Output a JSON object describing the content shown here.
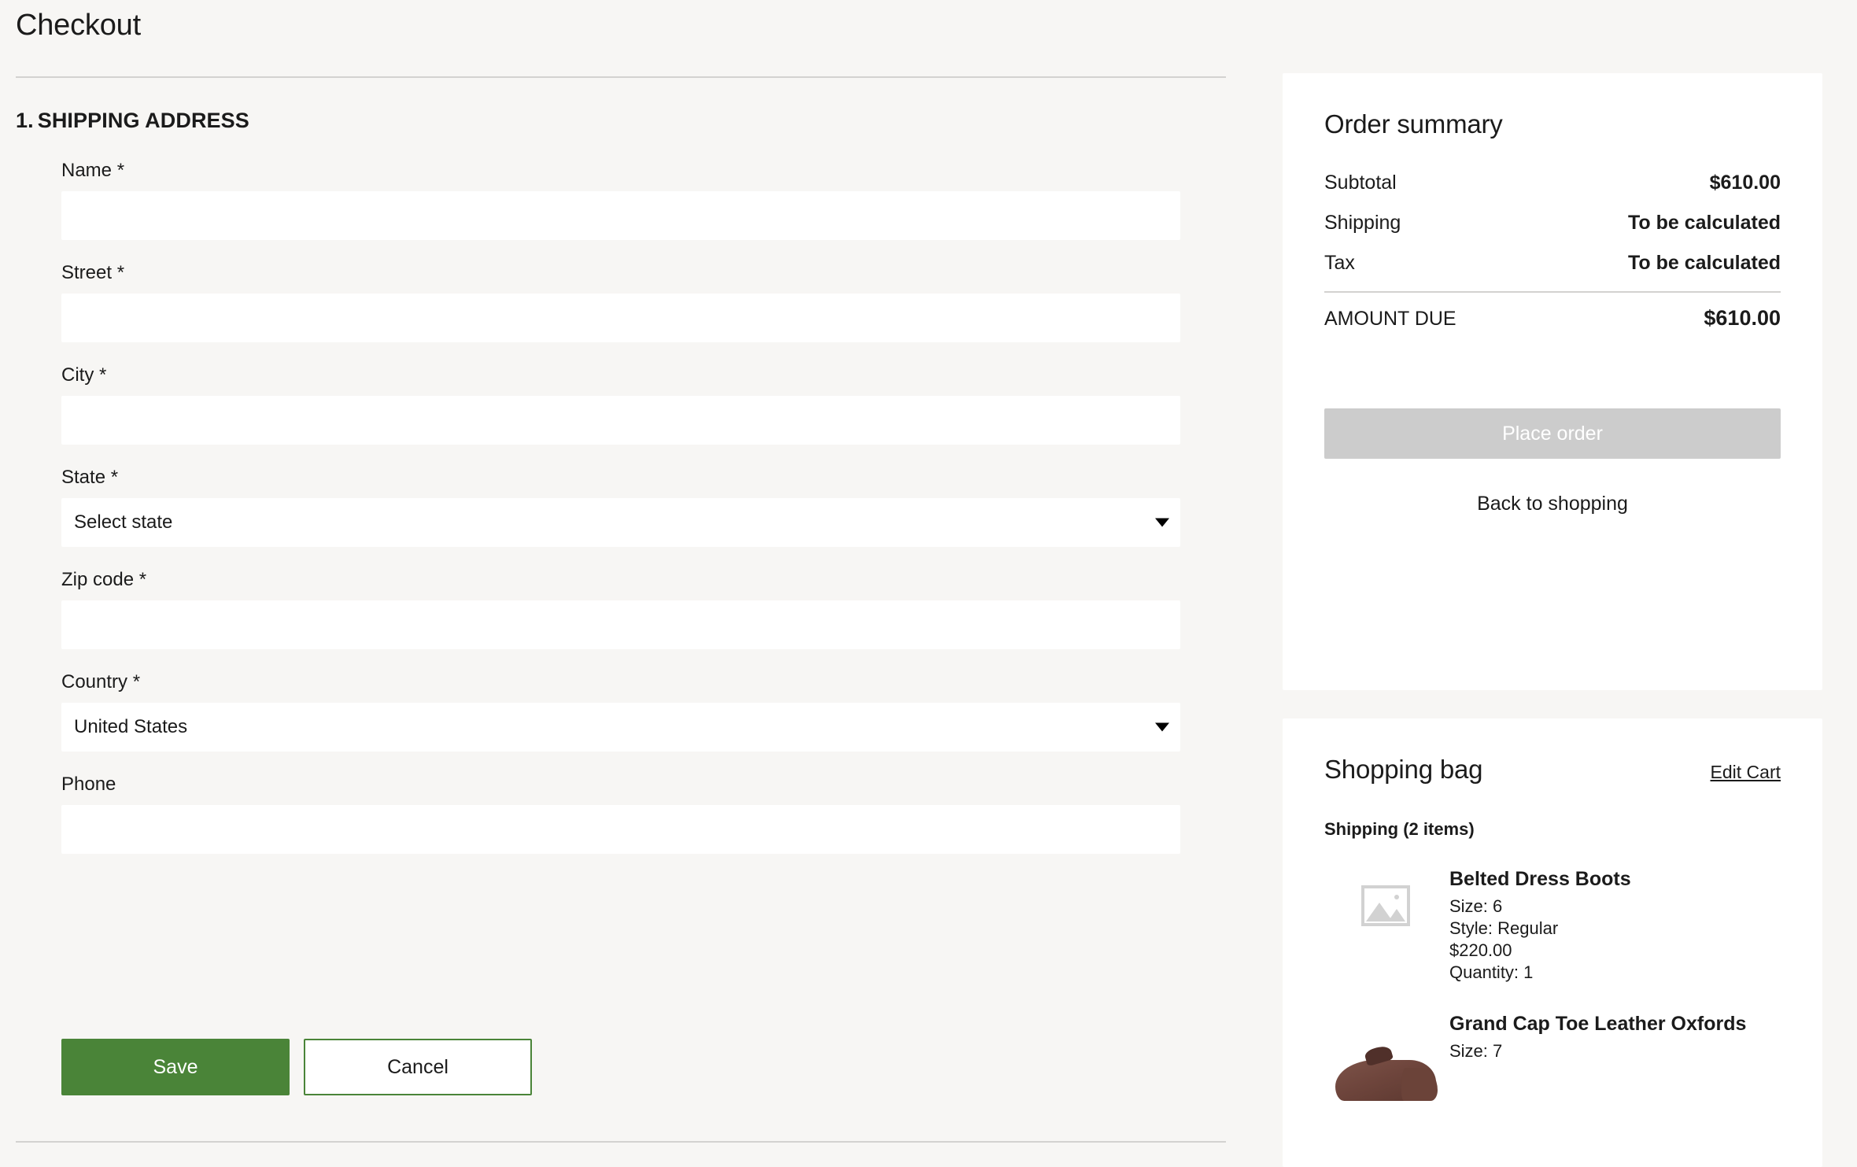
{
  "page": {
    "title": "Checkout"
  },
  "shipping_section": {
    "number": "1.",
    "heading": "SHIPPING ADDRESS",
    "fields": [
      {
        "label": "Name *",
        "type": "text",
        "value": "",
        "placeholder": ""
      },
      {
        "label": "Street *",
        "type": "text",
        "value": "",
        "placeholder": ""
      },
      {
        "label": "City *",
        "type": "text",
        "value": "",
        "placeholder": ""
      },
      {
        "label": "State *",
        "type": "select",
        "value": "Select state"
      },
      {
        "label": "Zip code *",
        "type": "text",
        "value": "",
        "placeholder": ""
      },
      {
        "label": "Country *",
        "type": "select",
        "value": "United States"
      },
      {
        "label": "Phone",
        "type": "text",
        "value": "",
        "placeholder": ""
      }
    ],
    "save_label": "Save",
    "cancel_label": "Cancel"
  },
  "order_summary": {
    "heading": "Order summary",
    "rows": [
      {
        "label": "Subtotal",
        "value": "$610.00"
      },
      {
        "label": "Shipping",
        "value": "To be calculated"
      },
      {
        "label": "Tax",
        "value": "To be calculated"
      }
    ],
    "total": {
      "label": "AMOUNT DUE",
      "value": "$610.00"
    },
    "place_order_label": "Place order",
    "back_to_shopping_label": "Back to shopping"
  },
  "shopping_bag": {
    "heading": "Shopping bag",
    "edit_cart_label": "Edit Cart",
    "group_label": "Shipping (2 items)",
    "items": [
      {
        "name": "Belted Dress Boots",
        "size": "Size: 6",
        "style": "Style: Regular",
        "price": "$220.00",
        "quantity": "Quantity: 1",
        "thumb": "image-placeholder-icon"
      },
      {
        "name": "Grand Cap Toe Leather Oxfords",
        "size": "Size: 7",
        "thumb": "shoe-photo"
      }
    ]
  },
  "colors": {
    "page_background": "#f7f6f4",
    "panel_background": "#ffffff",
    "accent_green": "#4a8438",
    "disabled_gray": "#cccccc",
    "divider": "#d3d2d0",
    "text": "#1b1b1b"
  }
}
